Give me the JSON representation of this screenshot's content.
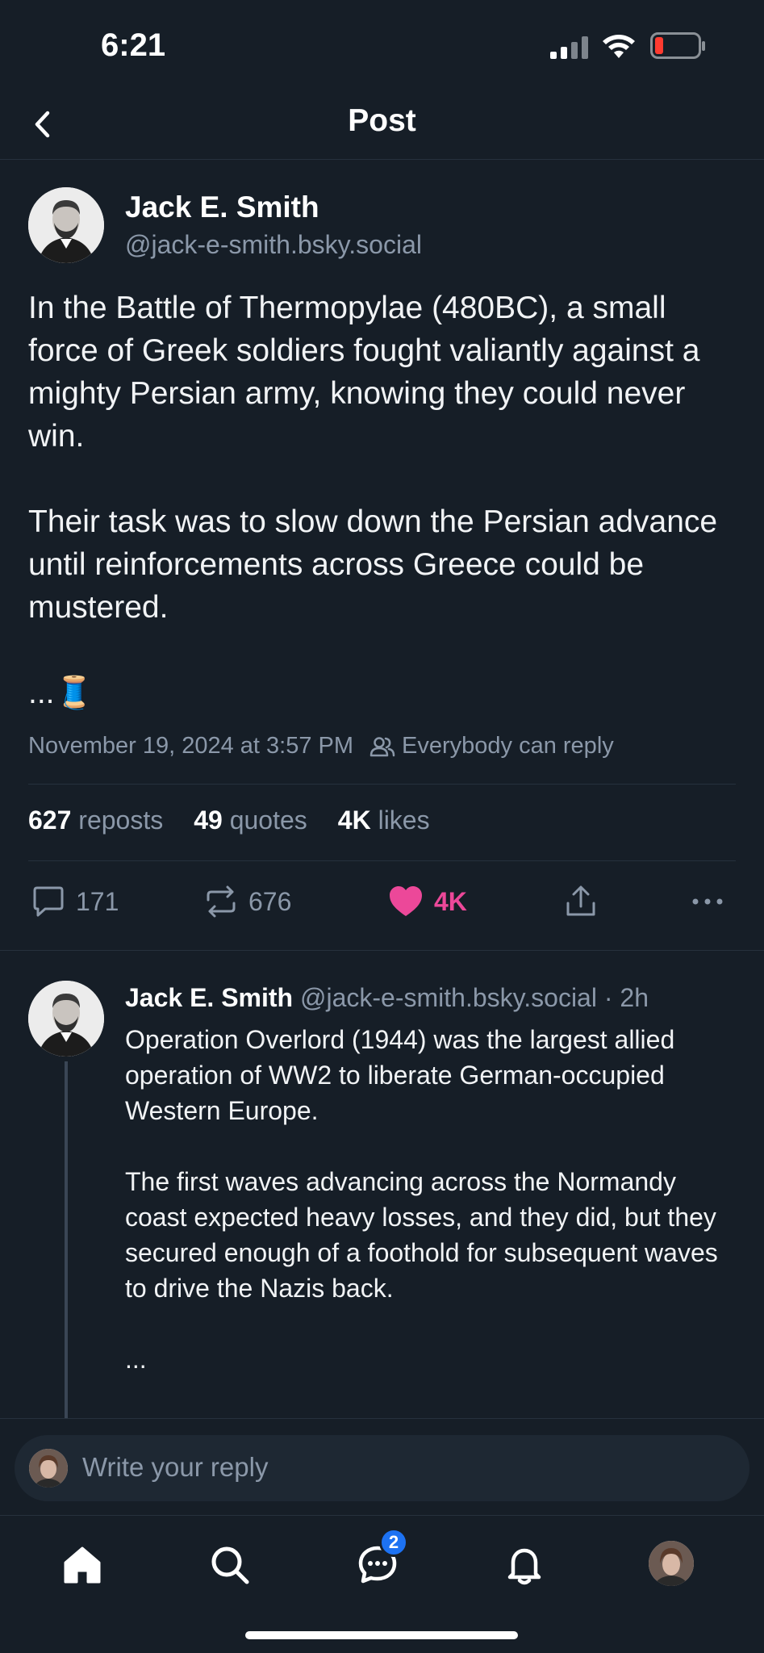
{
  "status_bar": {
    "time": "6:21"
  },
  "header": {
    "title": "Post"
  },
  "post": {
    "author_name": "Jack E. Smith",
    "author_handle": "@jack-e-smith.bsky.social",
    "body": "In the Battle of Thermopylae (480BC), a small force of Greek soldiers fought valiantly against a mighty Persian army, knowing they could never win.\n\nTheir task was to slow down the Persian advance until reinforcements across Greece could be mustered.\n\n...🧵",
    "timestamp": "November 19, 2024 at 3:57 PM",
    "reply_setting": "Everybody can reply",
    "reposts_count": "627",
    "reposts_label": "reposts",
    "quotes_count": "49",
    "quotes_label": "quotes",
    "likes_count": "4K",
    "likes_label": "likes",
    "actions": {
      "replies": "171",
      "reposts": "676",
      "likes": "4K"
    },
    "colors": {
      "like": "#ec4899"
    }
  },
  "reply": {
    "author_name": "Jack E. Smith",
    "meta": "@jack-e-smith.bsky.social · 2h",
    "body": "Operation Overlord (1944) was the largest allied operation of WW2 to liberate German-occupied Western Europe.\n\nThe first waves advancing across the Normandy coast expected heavy losses, and they did, but they secured enough of a foothold for subsequent waves to drive the Nazis back.\n\n..."
  },
  "composer": {
    "placeholder": "Write your reply"
  },
  "tabbar": {
    "items": [
      "home-icon",
      "search-icon",
      "chat-icon",
      "bell-icon",
      "profile-avatar"
    ],
    "chat_badge": "2",
    "badge_color": "#1d72f2"
  }
}
